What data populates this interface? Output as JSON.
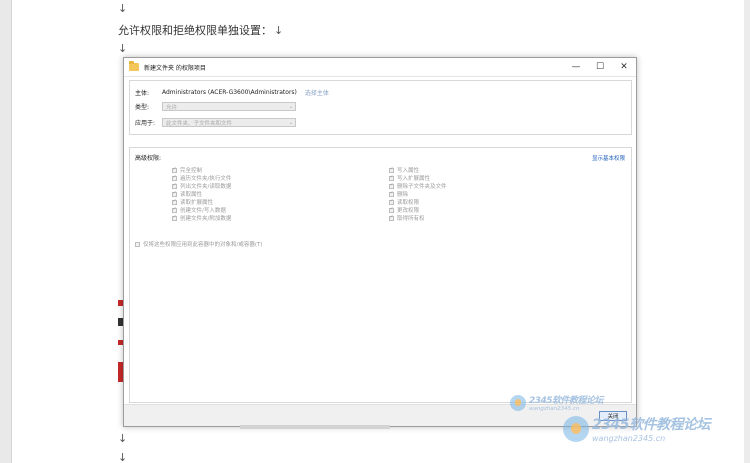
{
  "document": {
    "para_mark": "↓",
    "heading_line": "允许权限和拒绝权限单独设置：",
    "heading_mark": "↓"
  },
  "dialog": {
    "title": "新建文件夹 的权限项目",
    "minimize": "—",
    "maximize": "☐",
    "close": "✕",
    "principal_label": "主体:",
    "principal_value": "Administrators (ACER-G3600\\Administrators)",
    "select_principal_link": "选择主体",
    "type_label": "类型:",
    "type_value": "允许",
    "applies_label": "应用于:",
    "applies_value": "此文件夹、子文件夹和文件",
    "advanced_title": "高级权限:",
    "show_basic_link": "显示基本权限",
    "permissions_left": [
      "完全控制",
      "遍历文件夹/执行文件",
      "列出文件夹/读取数据",
      "读取属性",
      "读取扩展属性",
      "创建文件/写入数据",
      "创建文件夹/附加数据"
    ],
    "permissions_right": [
      "写入属性",
      "写入扩展属性",
      "删除子文件夹及文件",
      "删除",
      "读取权限",
      "更改权限",
      "取得所有权"
    ],
    "apply_only_label": "仅将这些权限应用到此容器中的对象和/或容器(T)",
    "close_button": "关闭"
  },
  "watermark": {
    "site_name": "2345软件教程论坛",
    "site_url": "wangzhan2345.cn"
  },
  "colors": {
    "link_blue": "#1f5fbd",
    "watermark_blue": "#96b9dc",
    "folder_yellow": "#f3c65a"
  }
}
